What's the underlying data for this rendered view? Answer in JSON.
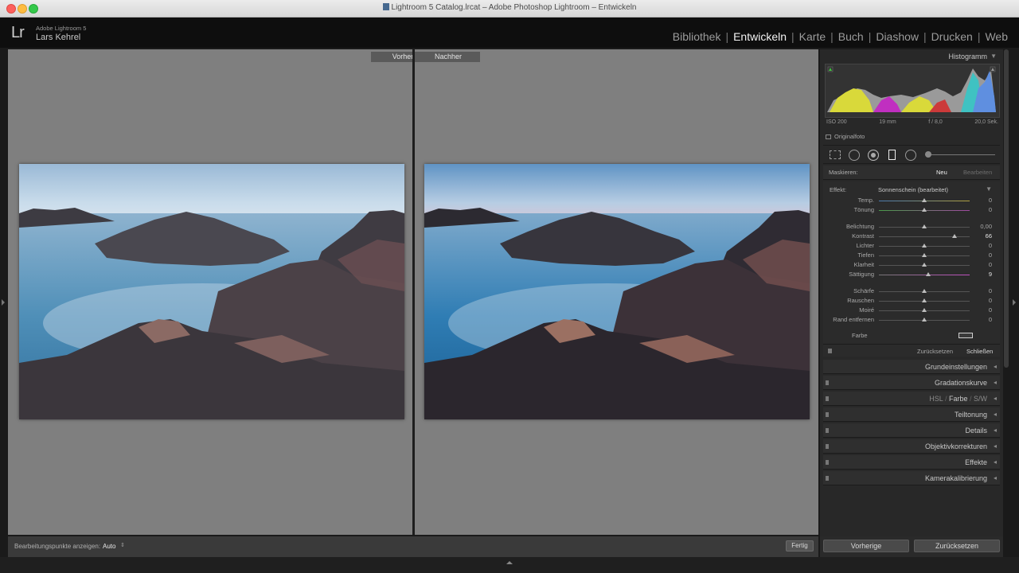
{
  "window": {
    "title": "Lightroom 5 Catalog.lrcat – Adobe Photoshop Lightroom – Entwickeln"
  },
  "identity": {
    "logo": "Lr",
    "version": "Adobe Lightroom 5",
    "user": "Lars Kehrel"
  },
  "modules": [
    {
      "label": "Bibliothek",
      "active": false
    },
    {
      "label": "Entwickeln",
      "active": true
    },
    {
      "label": "Karte",
      "active": false
    },
    {
      "label": "Buch",
      "active": false
    },
    {
      "label": "Diashow",
      "active": false
    },
    {
      "label": "Drucken",
      "active": false
    },
    {
      "label": "Web",
      "active": false
    }
  ],
  "view": {
    "before_label": "Vorher",
    "after_label": "Nachher"
  },
  "toolbar": {
    "edit_points_label": "Bearbeitungspunkte anzeigen:",
    "edit_points_value": "Auto",
    "done_label": "Fertig"
  },
  "histogram": {
    "title": "Histogramm",
    "iso": "ISO 200",
    "focal": "19 mm",
    "aperture": "f / 8,0",
    "shutter": "20,0 Sek.",
    "original_label": "Originalfoto"
  },
  "mask": {
    "label": "Maskieren:",
    "new_label": "Neu",
    "edit_label": "Bearbeiten"
  },
  "adjust": {
    "effect_label": "Effekt:",
    "effect_value": "Sonnenschein (bearbeitet)",
    "sliders": [
      {
        "label": "Temp.",
        "value": "0",
        "pos": 0.5
      },
      {
        "label": "Tönung",
        "value": "0",
        "pos": 0.5
      },
      {
        "label": "Belichtung",
        "value": "0,00",
        "pos": 0.5
      },
      {
        "label": "Kontrast",
        "value": "66",
        "pos": 0.83
      },
      {
        "label": "Lichter",
        "value": "0",
        "pos": 0.5
      },
      {
        "label": "Tiefen",
        "value": "0",
        "pos": 0.5
      },
      {
        "label": "Klarheit",
        "value": "0",
        "pos": 0.5
      },
      {
        "label": "Sättigung",
        "value": "9",
        "pos": 0.545
      },
      {
        "label": "Schärfe",
        "value": "0",
        "pos": 0.5
      },
      {
        "label": "Rauschen",
        "value": "0",
        "pos": 0.5
      },
      {
        "label": "Moiré",
        "value": "0",
        "pos": 0.5
      },
      {
        "label": "Rand entfernen",
        "value": "0",
        "pos": 0.5
      }
    ],
    "color_label": "Farbe",
    "reset_label": "Zurücksetzen",
    "close_label": "Schließen"
  },
  "panels": {
    "basic": "Grundeinstellungen",
    "tone_curve": "Gradationskurve",
    "hsl": "HSL",
    "color": "Farbe",
    "bw": "S/W",
    "split_toning": "Teiltonung",
    "details": "Details",
    "lens": "Objektivkorrekturen",
    "effects": "Effekte",
    "camera": "Kamerakalibrierung"
  },
  "buttons": {
    "previous": "Vorherige",
    "reset": "Zurücksetzen"
  }
}
